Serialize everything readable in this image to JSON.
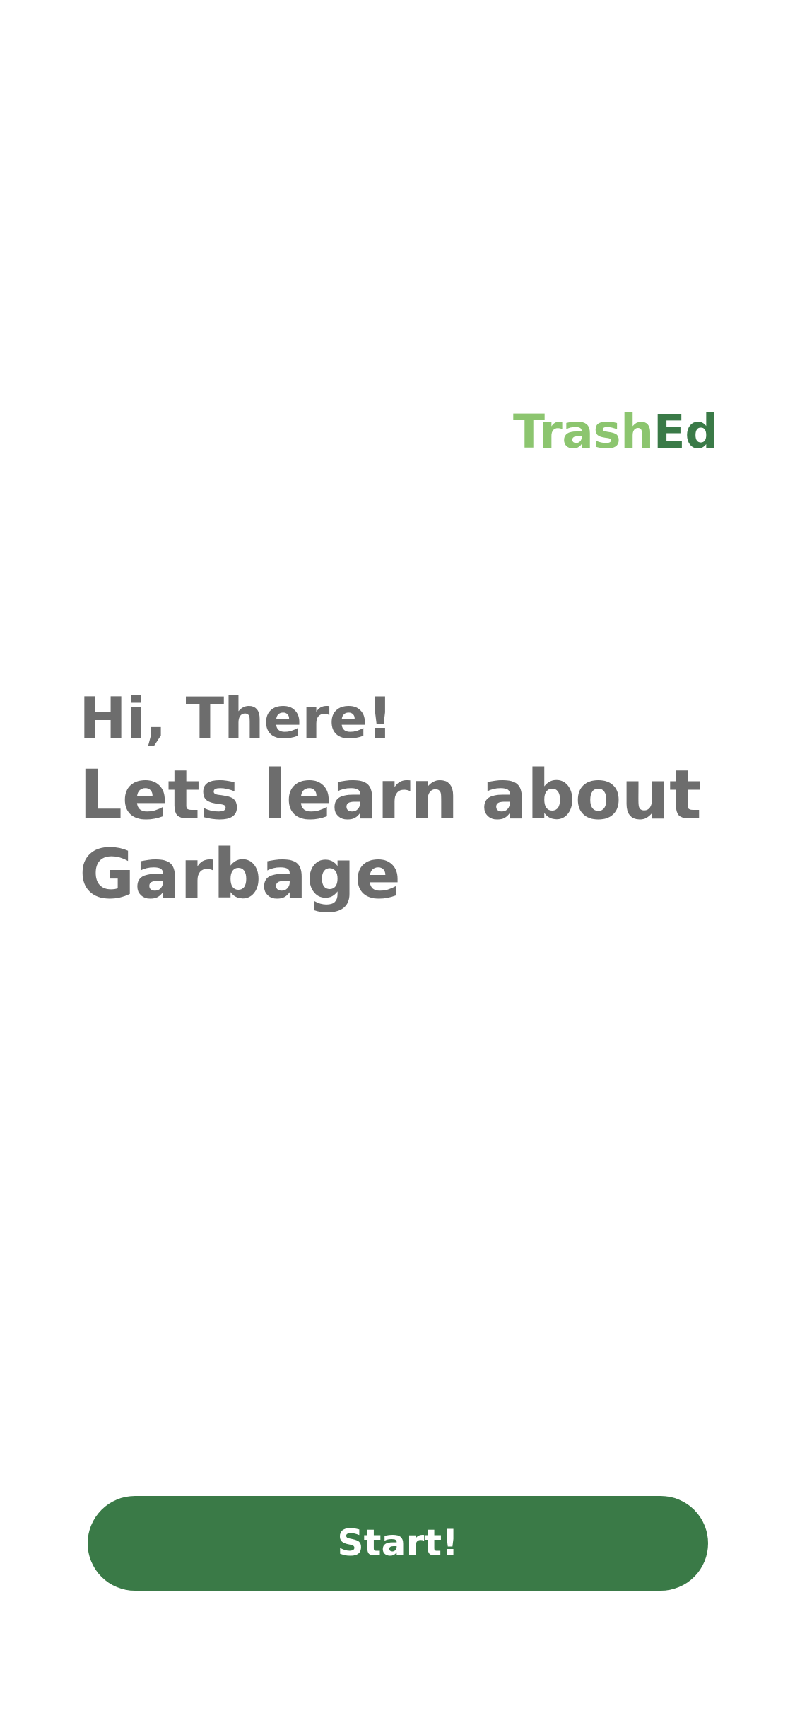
{
  "brand": {
    "part1": "Trash",
    "part2": "Ed",
    "part1_color": "#8cc56f",
    "part2_color": "#3a7a47"
  },
  "greeting": {
    "line1": "Hi, There!",
    "line2a": "Lets learn about",
    "line2b": "Garbage",
    "color": "#6d6d6d"
  },
  "actions": {
    "start_label": "Start!",
    "button_color": "#3a7a47"
  }
}
